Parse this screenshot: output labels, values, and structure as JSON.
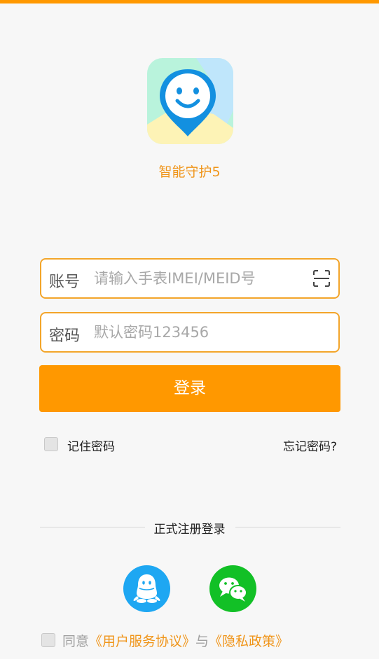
{
  "app": {
    "name": "智能守护5"
  },
  "account": {
    "label": "账号",
    "placeholder": "请输入手表IMEI/MEID号"
  },
  "password": {
    "label": "密码",
    "placeholder": "默认密码123456"
  },
  "login_button": "登录",
  "remember": {
    "label": "记住密码",
    "checked": false
  },
  "forgot_link": "忘记密码?",
  "divider_text": "正式注册登录",
  "social": {
    "qq_icon": "qq-icon",
    "wechat_icon": "wechat-icon"
  },
  "agreement": {
    "checked": false,
    "prefix": "同意",
    "terms_link": "《用户服务协议》",
    "and": "与",
    "privacy_link": "《隐私政策》"
  },
  "colors": {
    "accent": "#ff9800",
    "link": "#f0951a",
    "qq": "#1ea7f2",
    "wechat": "#12c026"
  }
}
